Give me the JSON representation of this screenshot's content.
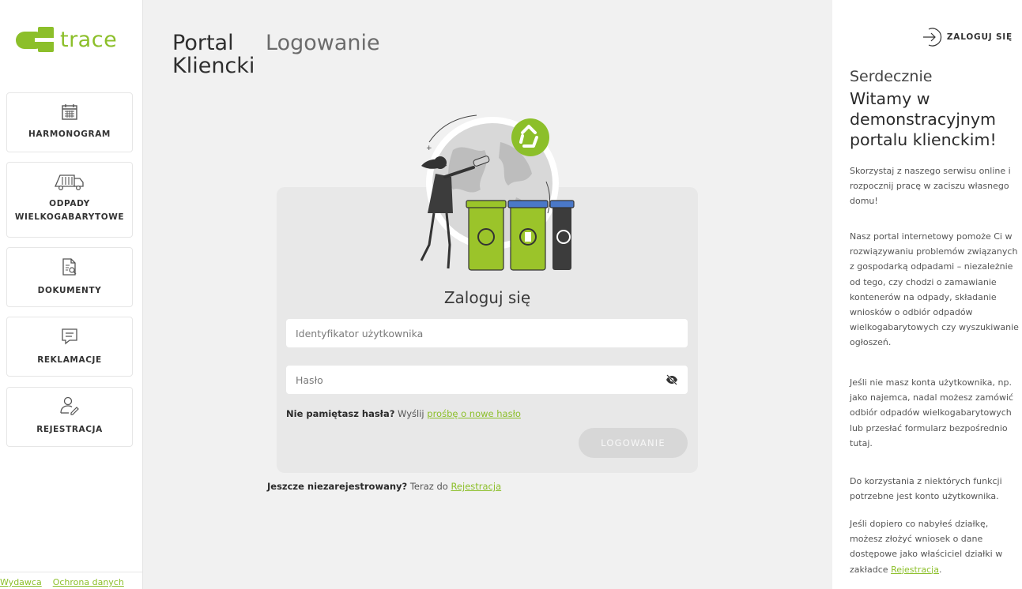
{
  "logo": {
    "text": "trace"
  },
  "nav": {
    "schedule": "HARMONOGRAM",
    "bulky_1": "ODPADY",
    "bulky_2": "WIELKOGABARYTOWE",
    "documents": "DOKUMENTY",
    "complaints": "REKLAMACJE",
    "registration": "REJESTRACJA"
  },
  "footer": {
    "publisher": "Wydawca",
    "privacy": "Ochrona danych"
  },
  "header": {
    "portal_line1": "Portal",
    "portal_line2": "Kliencki",
    "page": "Logowanie"
  },
  "login": {
    "title": "Zaloguj się",
    "username_placeholder": "Identyfikator użytkownika",
    "password_placeholder": "Hasło",
    "forgot_question": "Nie pamiętasz hasła?",
    "forgot_prefix": "Wyślij",
    "forgot_link": "prośbę o nowe hasło",
    "submit": "LOGOWANIE",
    "not_registered": "Jeszcze niezarejestrowany?",
    "register_prefix": "Teraz do",
    "register_link": "Rejestracja"
  },
  "right": {
    "login_link": "ZALOGUJ SIĘ",
    "greet_line1": "Serdecznie",
    "greet_line2": "Witamy w demonstracyjnym portalu klienckim!",
    "p1": "Skorzystaj z naszego serwisu online i rozpocznij pracę w zaciszu własnego domu!",
    "p2": "Nasz portal internetowy pomoże Ci w rozwiązywaniu problemów związanych z gospodarką odpadami – niezależnie od tego, czy chodzi o zamawianie kontenerów na odpady, składanie wniosków o odbiór odpadów wielkogabarytowych czy wyszukiwanie ogłoszeń.",
    "p3": "Jeśli nie masz konta użytkownika, np. jako najemca, nadal możesz zamówić odbiór odpadów wielkogabarytowych lub przesłać formularz bezpośrednio tutaj.",
    "p4": "Do korzystania z niektórych funkcji potrzebne jest konto użytkownika.",
    "p5_prefix": "Jeśli dopiero co nabyłeś działkę, możesz złożyć wniosek o dane dostępowe jako właściciel działki w zakładce",
    "p5_link": "Rejestracja",
    "p5_suffix": "."
  },
  "colors": {
    "accent": "#8cbf2a",
    "bin_green": "#9bc42a",
    "bin_blue": "#4a78c8",
    "bin_dark": "#3c3c3c"
  }
}
